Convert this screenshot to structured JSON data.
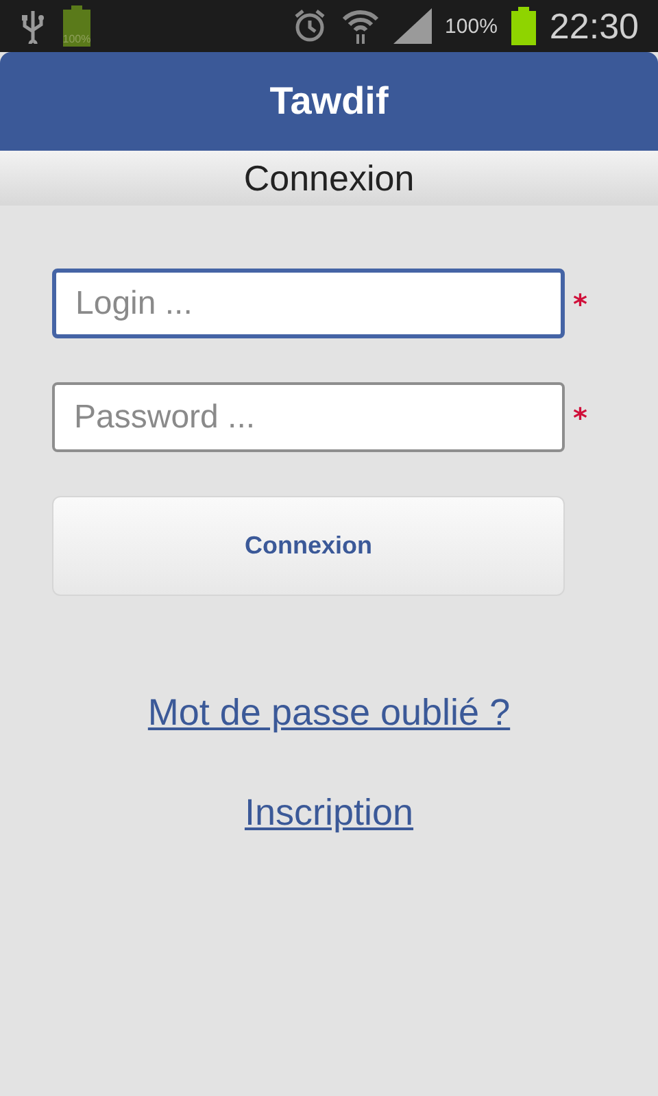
{
  "status_bar": {
    "notification_battery_text": "100%",
    "battery_percent": "100%",
    "time": "22:30"
  },
  "app_bar": {
    "title": "Tawdif"
  },
  "subheader": {
    "title": "Connexion"
  },
  "fields": [
    {
      "placeholder": "Login ...",
      "required_mark": "*",
      "focused": true
    },
    {
      "placeholder": "Password ...",
      "required_mark": "*",
      "focused": false
    }
  ],
  "submit_button": {
    "label": "Connexion"
  },
  "links": [
    {
      "label": "Mot de passe oublié ?"
    },
    {
      "label": "Inscription"
    }
  ]
}
